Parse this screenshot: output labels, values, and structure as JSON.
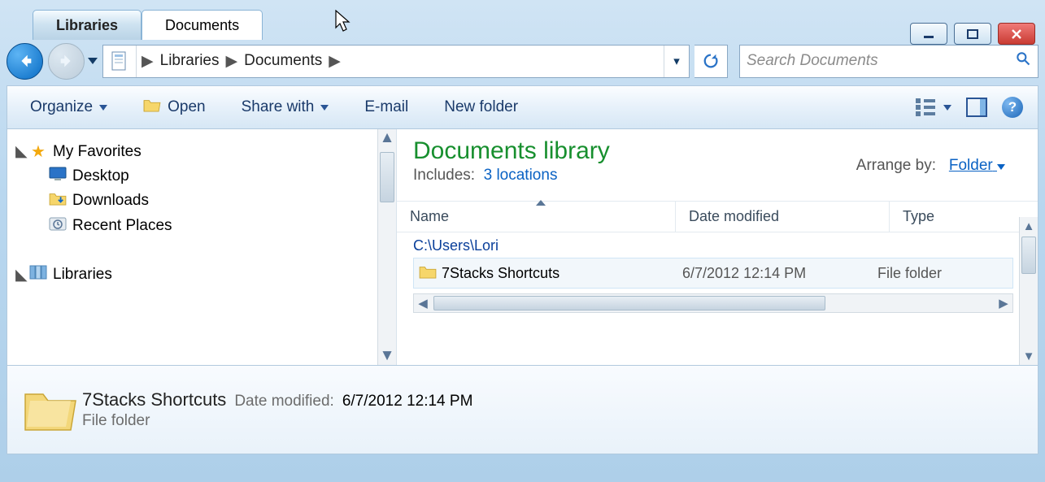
{
  "tabs": {
    "libraries": "Libraries",
    "documents": "Documents"
  },
  "breadcrumb": {
    "root": "Libraries",
    "current": "Documents"
  },
  "search": {
    "placeholder": "Search Documents"
  },
  "toolbar": {
    "organize": "Organize",
    "open": "Open",
    "share": "Share with",
    "email": "E-mail",
    "new_folder": "New folder"
  },
  "tree": {
    "favorites": "My Favorites",
    "desktop": "Desktop",
    "downloads": "Downloads",
    "recent": "Recent Places",
    "libraries": "Libraries"
  },
  "library": {
    "title": "Documents library",
    "includes_label": "Includes:",
    "includes_link": "3 locations",
    "arrange_label": "Arrange by:",
    "arrange_value": "Folder"
  },
  "columns": {
    "name": "Name",
    "date": "Date modified",
    "type": "Type"
  },
  "group_path": "C:\\Users\\Lori",
  "item": {
    "name": "7Stacks Shortcuts",
    "date": "6/7/2012 12:14 PM",
    "type": "File folder"
  },
  "details": {
    "name": "7Stacks Shortcuts",
    "date_label": "Date modified:",
    "date": "6/7/2012 12:14 PM",
    "type": "File folder"
  }
}
